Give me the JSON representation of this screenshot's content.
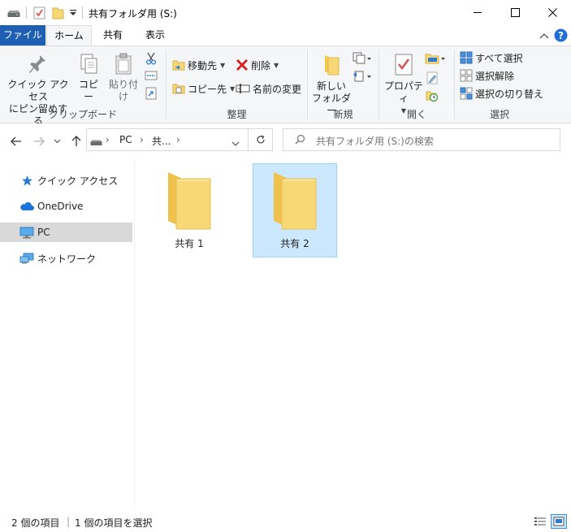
{
  "window": {
    "title": "共有フォルダ用 (S:)"
  },
  "tabs": {
    "file": "ファイル",
    "home": "ホーム",
    "share": "共有",
    "view": "表示"
  },
  "ribbon": {
    "clipboard": {
      "pin_line1": "クイック アクセス",
      "pin_line2": "にピン留めする",
      "copy": "コピー",
      "paste": "貼り付け",
      "label": "クリップボード"
    },
    "organize": {
      "move_to": "移動先",
      "copy_to": "コピー先",
      "delete": "削除",
      "rename": "名前の変更",
      "label": "整理"
    },
    "new": {
      "new_folder_line1": "新しい",
      "new_folder_line2": "フォルダー",
      "label": "新規"
    },
    "open": {
      "properties": "プロパティ",
      "label": "開く"
    },
    "select": {
      "select_all": "すべて選択",
      "select_none": "選択解除",
      "invert": "選択の切り替え",
      "label": "選択"
    }
  },
  "address": {
    "crumbs": [
      "PC",
      "共..."
    ],
    "search_placeholder": "共有フォルダ用 (S:)の検索"
  },
  "nav": {
    "items": [
      {
        "label": "クイック アクセス",
        "icon": "star-icon"
      },
      {
        "label": "OneDrive",
        "icon": "cloud-icon"
      },
      {
        "label": "PC",
        "icon": "computer-icon"
      },
      {
        "label": "ネットワーク",
        "icon": "network-icon"
      }
    ]
  },
  "content": {
    "items": [
      {
        "name": "共有 1",
        "selected": false
      },
      {
        "name": "共有 2",
        "selected": true
      }
    ]
  },
  "status": {
    "count": "2 個の項目",
    "selected": "1 個の項目を選択"
  },
  "colors": {
    "file_tab": "#1e5fb3",
    "selection_fill": "#cce8ff",
    "selection_border": "#99d1ff",
    "folder": "#f8d775"
  }
}
